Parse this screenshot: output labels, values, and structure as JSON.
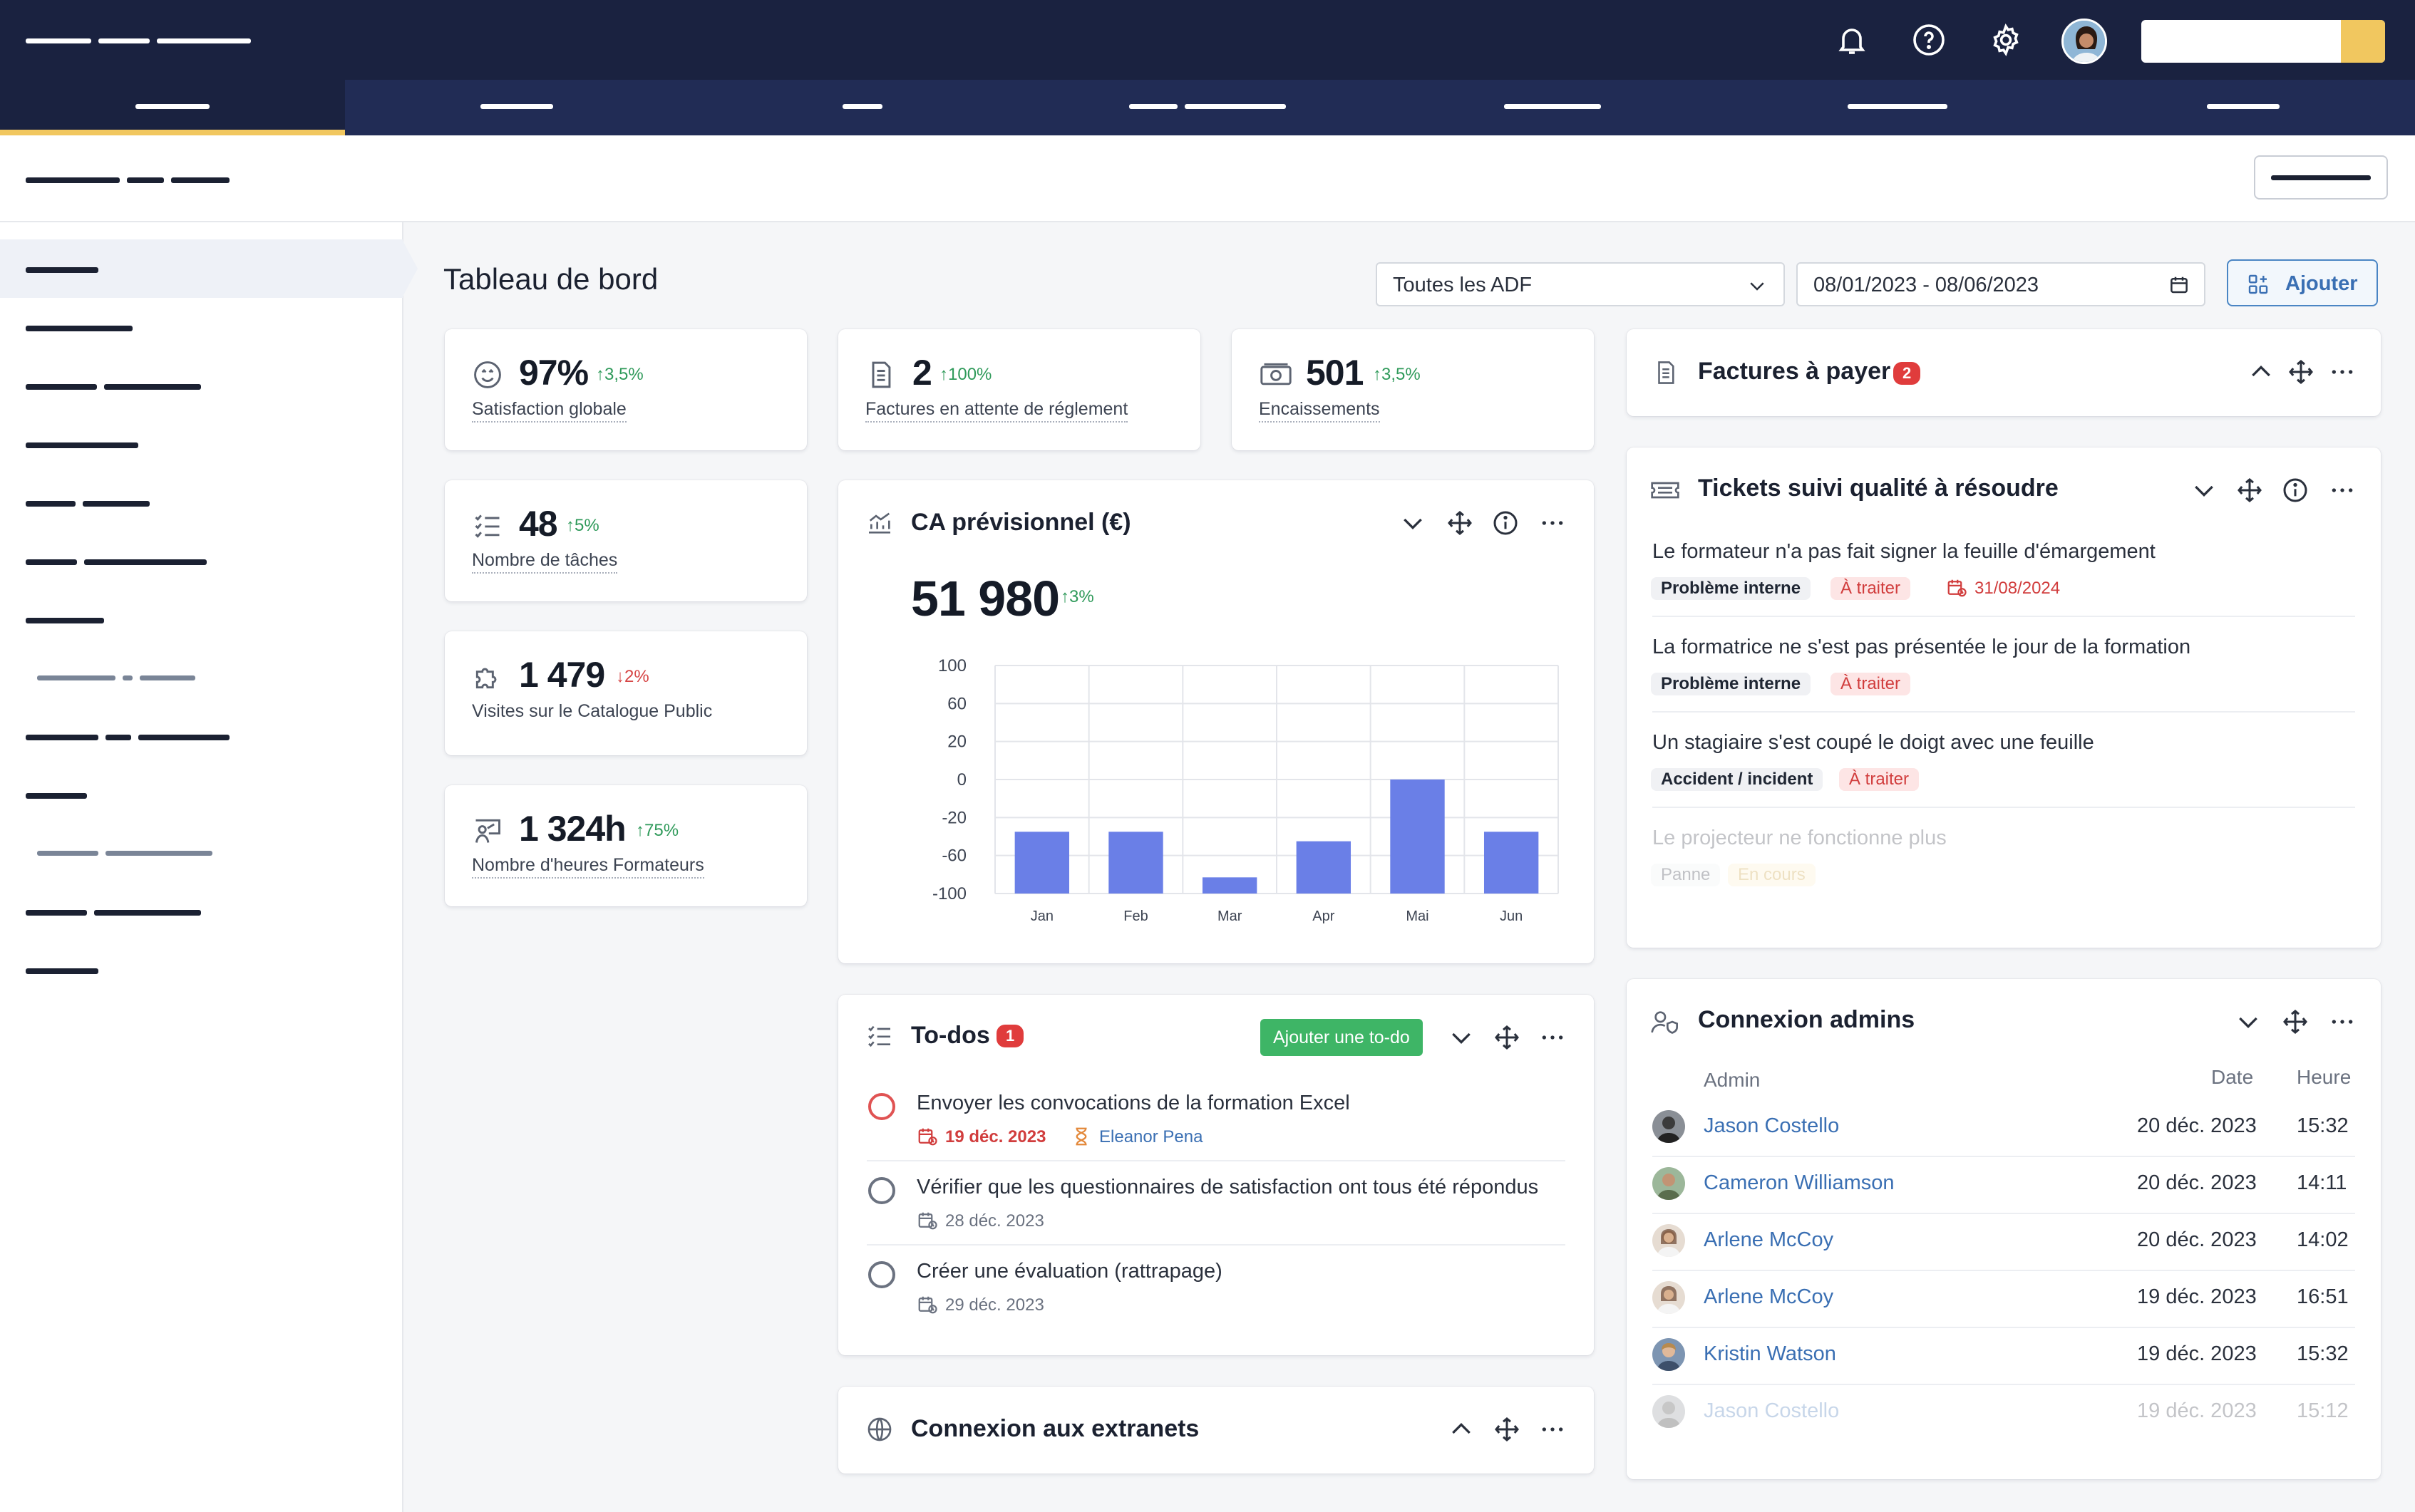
{
  "top_icons": [
    "bell-icon",
    "help-icon",
    "gear-icon"
  ],
  "page": {
    "title": "Tableau de bord"
  },
  "filters": {
    "adf_select": "Toutes les ADF",
    "date_range": "08/01/2023 - 08/06/2023",
    "add_label": "Ajouter"
  },
  "kpis": [
    {
      "value": "97%",
      "delta": "3,5%",
      "direction": "up",
      "label": "Satisfaction globale",
      "icon": "smiley-icon"
    },
    {
      "value": "2",
      "delta": "100%",
      "direction": "up",
      "label": "Factures en attente de réglement",
      "icon": "invoice-icon"
    },
    {
      "value": "501",
      "delta": "3,5%",
      "direction": "up",
      "label": "Encaissements",
      "icon": "cash-icon"
    },
    {
      "value": "48",
      "delta": "5%",
      "direction": "up",
      "label": "Nombre de tâches",
      "icon": "task-list-icon"
    },
    {
      "value": "1 479",
      "delta": "2%",
      "direction": "down",
      "label": "Visites sur le Catalogue Public",
      "icon": "puzzle-icon"
    },
    {
      "value": "1 324h",
      "delta": "75%",
      "direction": "up",
      "label": "Nombre d'heures Formateurs",
      "icon": "trainer-icon"
    }
  ],
  "ca_card": {
    "title": "CA prévisionnel (€)",
    "total": "51 980",
    "delta": "3%"
  },
  "chart_data": {
    "type": "bar",
    "title": "CA prévisionnel (€)",
    "categories": [
      "Jan",
      "Feb",
      "Mar",
      "Apr",
      "Mai",
      "Jun"
    ],
    "yticks": [
      "100",
      "60",
      "20",
      "0",
      "-20",
      "-60",
      "-100"
    ],
    "values": [
      -35,
      -35,
      -83,
      -45,
      0,
      -35
    ],
    "baseline": -100,
    "ylim": [
      -100,
      100
    ],
    "grid": true,
    "color": "#6a7fe7"
  },
  "todos": {
    "title": "To-dos",
    "badge": "1",
    "add_label": "Ajouter une to-do",
    "items": [
      {
        "title": "Envoyer les convocations de la formation Excel",
        "date": "19 déc. 2023",
        "overdue": true,
        "assignee": "Eleanor Pena"
      },
      {
        "title": "Vérifier que les questionnaires de satisfaction ont tous été répondus",
        "date": "28 déc. 2023",
        "overdue": false,
        "assignee": ""
      },
      {
        "title": "Créer une évaluation (rattrapage)",
        "date": "29 déc. 2023",
        "overdue": false,
        "assignee": ""
      }
    ]
  },
  "extranets": {
    "title": "Connexion aux extranets"
  },
  "factures": {
    "title": "Factures à payer",
    "badge": "2"
  },
  "tickets": {
    "title": "Tickets suivi qualité à résoudre",
    "items": [
      {
        "title": "Le formateur n'a pas fait signer la feuille d'émargement",
        "tag": "Problème interne",
        "status": "À traiter",
        "date": "31/08/2024"
      },
      {
        "title": "La formatrice ne s'est pas présentée le jour de la formation",
        "tag": "Problème interne",
        "status": "À traiter",
        "date": ""
      },
      {
        "title": "Un stagiaire s'est coupé le doigt avec une feuille",
        "tag": "Accident / incident",
        "status": "À traiter",
        "date": ""
      },
      {
        "title": "Le projecteur ne fonctionne plus",
        "tag": "Panne",
        "status": "En cours",
        "date": ""
      }
    ]
  },
  "admins": {
    "title": "Connexion admins",
    "columns": {
      "admin": "Admin",
      "date": "Date",
      "heure": "Heure"
    },
    "rows": [
      {
        "name": "Jason Costello",
        "date": "20 déc. 2023",
        "time": "15:32"
      },
      {
        "name": "Cameron Williamson",
        "date": "20 déc. 2023",
        "time": "14:11"
      },
      {
        "name": "Arlene McCoy",
        "date": "20 déc. 2023",
        "time": "14:02"
      },
      {
        "name": "Arlene McCoy",
        "date": "19 déc. 2023",
        "time": "16:51"
      },
      {
        "name": "Kristin Watson",
        "date": "19 déc. 2023",
        "time": "15:32"
      },
      {
        "name": "Jason Costello",
        "date": "19 déc. 2023",
        "time": "15:12"
      }
    ]
  }
}
